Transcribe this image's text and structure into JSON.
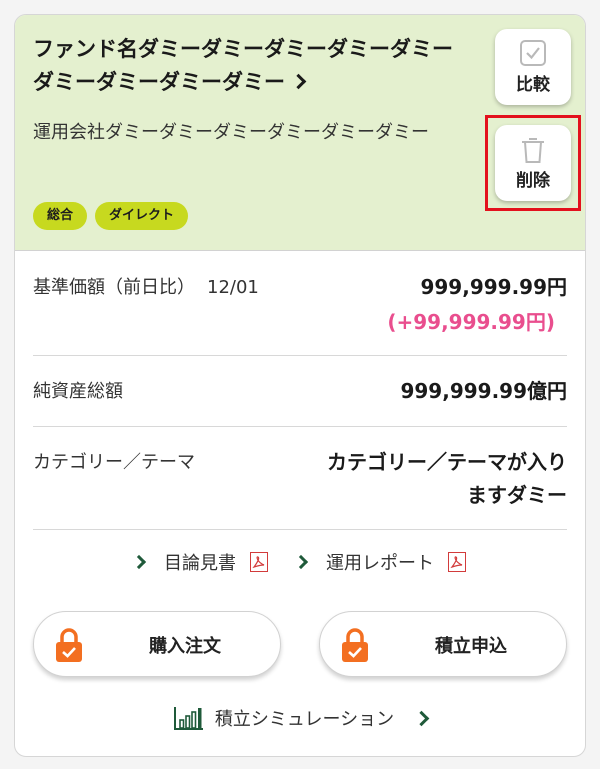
{
  "fund": {
    "name": "ファンド名ダミーダミーダミーダミーダミーダミーダミーダミーダミー",
    "company": "運用会社ダミーダミーダミーダミーダミーダミー",
    "badges": [
      "総合",
      "ダイレクト"
    ]
  },
  "actions": {
    "compare_label": "比較",
    "delete_label": "削除"
  },
  "details": {
    "nav_label": "基準価額（前日比）",
    "nav_date": "12/01",
    "nav_value": "999,999.99円",
    "nav_diff": "(+99,999.99円)",
    "assets_label": "純資産総額",
    "assets_value": "999,999.99億円",
    "category_label": "カテゴリー／テーマ",
    "category_value": "カテゴリー／テーマが入りますダミー"
  },
  "docs": {
    "prospectus_label": "目論見書",
    "report_label": "運用レポート"
  },
  "orders": {
    "buy_label": "購入注文",
    "tsumitate_label": "積立申込"
  },
  "simulation": {
    "label": "積立シミュレーション"
  },
  "colors": {
    "header_bg": "#e4f0cf",
    "badge_bg": "#c7d91f",
    "diff_pink": "#e94e8e",
    "lock_orange": "#f36f21",
    "highlight_red": "#e3111d"
  }
}
